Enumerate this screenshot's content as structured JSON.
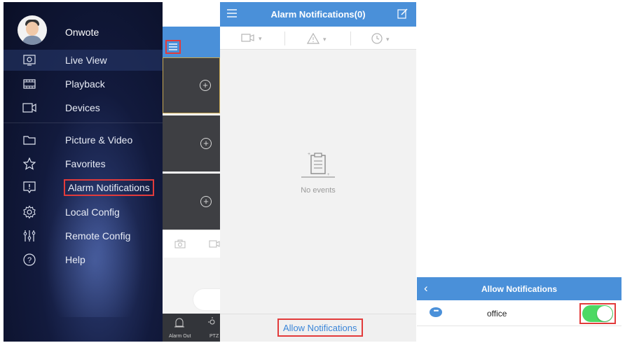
{
  "drawer": {
    "user": {
      "name": "Onwote",
      "avatar_icon": "user-avatar-icon"
    },
    "items": [
      {
        "label": "Live View",
        "icon": "live-view-icon"
      },
      {
        "label": "Playback",
        "icon": "film-icon"
      },
      {
        "label": "Devices",
        "icon": "camera-device-icon"
      },
      {
        "label": "Picture & Video",
        "icon": "folder-icon"
      },
      {
        "label": "Favorites",
        "icon": "star-icon"
      },
      {
        "label": "Alarm Notifications",
        "icon": "alarm-icon"
      },
      {
        "label": "Local Config",
        "icon": "gear-icon"
      },
      {
        "label": "Remote Config",
        "icon": "sliders-icon"
      },
      {
        "label": "Help",
        "icon": "help-icon"
      }
    ],
    "highlighted_item": "Alarm Notifications"
  },
  "live_view": {
    "menu_icon": "menu-icon",
    "bottom_bar": {
      "label1": "Alarm Out",
      "label2": "PTZ"
    }
  },
  "alarm": {
    "title": "Alarm Notifications(0)",
    "filters": [
      {
        "icon": "camera-filter-icon"
      },
      {
        "icon": "warning-filter-icon"
      },
      {
        "icon": "clock-filter-icon"
      }
    ],
    "empty_text": "No events",
    "footer_button": "Allow Notifications"
  },
  "allow": {
    "title": "Allow Notifications",
    "row_label": "office",
    "toggle_on": true
  },
  "colors": {
    "header_blue": "#4a90d9",
    "highlight_red": "#e23b3b",
    "toggle_green": "#4cd964",
    "drawer_bg": "#0a0f26"
  }
}
